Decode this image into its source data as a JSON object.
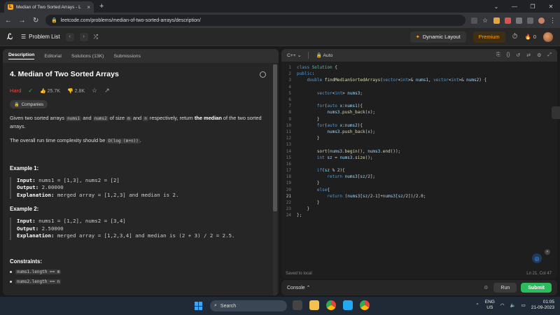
{
  "browser": {
    "tab_title": "Median of Two Sorted Arrays - L",
    "url": "leetcode.com/problems/median-of-two-sorted-arrays/description/"
  },
  "lc_nav": {
    "problem_list": "Problem List",
    "dynamic_layout": "Dynamic Layout",
    "premium": "Premium",
    "streak": "0"
  },
  "left": {
    "tabs": [
      "Description",
      "Editorial",
      "Solutions (13K)",
      "Submissions"
    ],
    "title": "4. Median of Two Sorted Arrays",
    "difficulty": "Hard",
    "likes": "25.7K",
    "dislikes": "2.8K",
    "companies": "Companies",
    "desc1_a": "Given two sorted arrays ",
    "desc1_c1": "nums1",
    "desc1_b": " and ",
    "desc1_c2": "nums2",
    "desc1_c": " of size ",
    "desc1_c3": "m",
    "desc1_d": " and ",
    "desc1_c4": "n",
    "desc1_e": " respectively, return ",
    "desc1_bold": "the median",
    "desc1_f": " of the two sorted arrays.",
    "desc2_a": "The overall run time complexity should be ",
    "desc2_code": "O(log (m+n))",
    "desc2_b": ".",
    "ex1_title": "Example 1:",
    "ex1_input_label": "Input:",
    "ex1_input": " nums1 = [1,3], nums2 = [2]",
    "ex1_output_label": "Output:",
    "ex1_output": " 2.00000",
    "ex1_expl_label": "Explanation:",
    "ex1_expl": " merged array = [1,2,3] and median is 2.",
    "ex2_title": "Example 2:",
    "ex2_input_label": "Input:",
    "ex2_input": " nums1 = [1,2], nums2 = [3,4]",
    "ex2_output_label": "Output:",
    "ex2_output": " 2.50000",
    "ex2_expl_label": "Explanation:",
    "ex2_expl": " merged array = [1,2,3,4] and median is (2 + 3) / 2 = 2.5.",
    "constraints_title": "Constraints:",
    "constraints": [
      "nums1.length == m",
      "nums2.length == n"
    ]
  },
  "editor": {
    "language": "C++",
    "mode": "Auto",
    "saved": "Saved to local",
    "position": "Ln 21, Col 47",
    "current_line": 21,
    "lines": [
      "class Solution {",
      "public:",
      "    double findMedianSortedArrays(vector<int>& nums1, vector<int>& nums2) {",
      "",
      "        vector<int> nums3;",
      "",
      "        for(auto x:nums1){",
      "            nums3.push_back(x);",
      "        }",
      "        for(auto x:nums2){",
      "            nums3.push_back(x);",
      "        }",
      "",
      "        sort(nums3.begin(), nums3.end());",
      "        int sz = nums3.size();",
      "",
      "        if(sz % 2){",
      "            return nums3[sz/2];",
      "        }",
      "        else{",
      "            return (nums3[sz/2-1]+nums3[sz/2])/2.0;",
      "        }",
      "    }",
      "};"
    ]
  },
  "console": {
    "label": "Console",
    "run": "Run",
    "submit": "Submit"
  },
  "taskbar": {
    "search": "Search",
    "lang1": "ENG",
    "lang2": "US",
    "time": "01:05",
    "date": "21-09-2023"
  },
  "colors": {
    "accent": "#ffa116",
    "hard": "#ef4743",
    "submit": "#2cbb5d"
  }
}
